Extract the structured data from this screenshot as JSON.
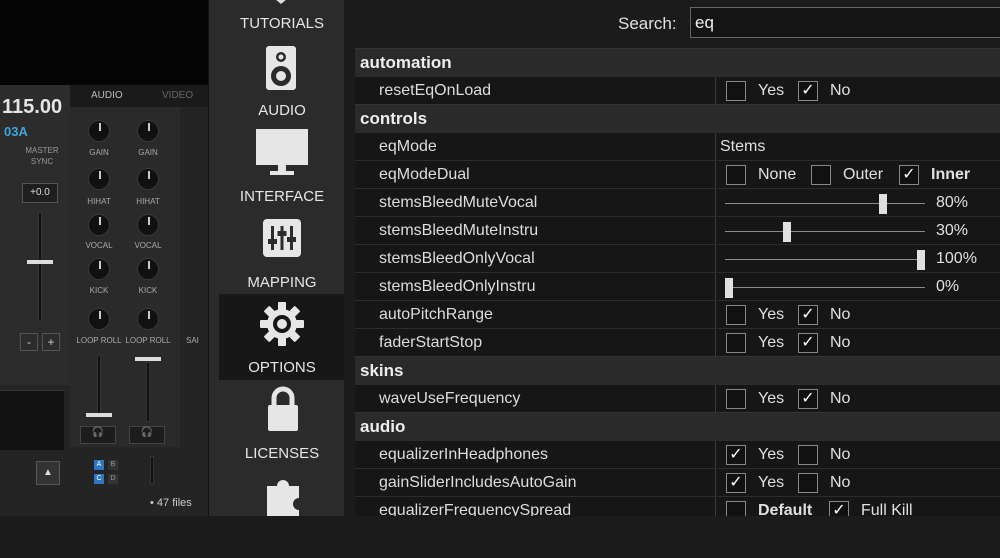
{
  "background_app": {
    "bpm": "115.00",
    "key": "03A",
    "master_sync": "MASTER SYNC",
    "pitch": "+0.0",
    "tabs": [
      "AUDIO",
      "VIDEO"
    ],
    "knob_labels": [
      "GAIN",
      "HIHAT",
      "VOCAL",
      "KICK",
      "LOOP ROLL"
    ],
    "minus": "-",
    "plus": "+",
    "files_count": "47 files",
    "cut_label": "SAI",
    "up": "▲",
    "ab": [
      "A",
      "B",
      "C",
      "D"
    ]
  },
  "nav": [
    {
      "label": "TUTORIALS",
      "icon": "tutorials-icon"
    },
    {
      "label": "AUDIO",
      "icon": "speaker-icon"
    },
    {
      "label": "INTERFACE",
      "icon": "monitor-icon"
    },
    {
      "label": "MAPPING",
      "icon": "sliders-icon"
    },
    {
      "label": "OPTIONS",
      "icon": "gear-icon",
      "selected": true
    },
    {
      "label": "LICENSES",
      "icon": "lock-icon"
    },
    {
      "label": "",
      "icon": "puzzle-icon"
    }
  ],
  "search": {
    "label": "Search:",
    "value": "eq"
  },
  "sections": {
    "automation": "automation",
    "controls": "controls",
    "skins": "skins",
    "audio": "audio"
  },
  "rows": {
    "resetEqOnLoad": {
      "name": "resetEqOnLoad",
      "yes": "Yes",
      "no": "No",
      "value": "No"
    },
    "eqMode": {
      "name": "eqMode",
      "value": "Stems"
    },
    "eqModeDual": {
      "name": "eqModeDual",
      "opt1": "None",
      "opt2": "Outer",
      "opt3": "Inner",
      "value": "Inner"
    },
    "stemsBleedMuteVocal": {
      "name": "stemsBleedMuteVocal",
      "value": "80%",
      "level": 0.8
    },
    "stemsBleedMuteInstru": {
      "name": "stemsBleedMuteInstru",
      "value": "30%",
      "level": 0.3
    },
    "stemsBleedOnlyVocal": {
      "name": "stemsBleedOnlyVocal",
      "value": "100%",
      "level": 1.0
    },
    "stemsBleedOnlyInstru": {
      "name": "stemsBleedOnlyInstru",
      "value": "0%",
      "level": 0.0
    },
    "autoPitchRange": {
      "name": "autoPitchRange",
      "yes": "Yes",
      "no": "No",
      "value": "No"
    },
    "faderStartStop": {
      "name": "faderStartStop",
      "yes": "Yes",
      "no": "No",
      "value": "No"
    },
    "waveUseFrequency": {
      "name": "waveUseFrequency",
      "yes": "Yes",
      "no": "No",
      "value": "No"
    },
    "equalizerInHeadphones": {
      "name": "equalizerInHeadphones",
      "yes": "Yes",
      "no": "No",
      "value": "Yes"
    },
    "gainSliderIncludesAutoGain": {
      "name": "gainSliderIncludesAutoGain",
      "yes": "Yes",
      "no": "No",
      "value": "Yes"
    },
    "equalizerFrequencySpread": {
      "name": "equalizerFrequencySpread",
      "opt1": "Default",
      "opt2": "Full Kill",
      "value": "Full Kill"
    }
  },
  "check_glyph": "✓",
  "colors": {
    "accent_blue": "#3fa3e0",
    "background": "#1b1b1b",
    "selected_nav": "#171717"
  }
}
